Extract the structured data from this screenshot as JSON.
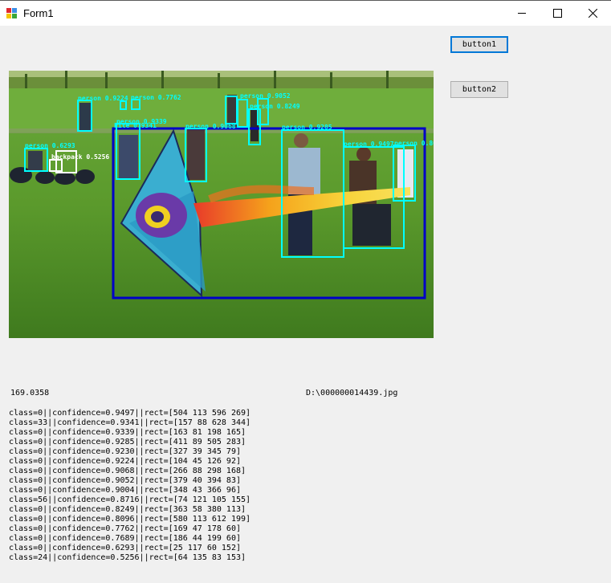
{
  "window": {
    "title": "Form1",
    "controls": [
      "minimize",
      "maximize",
      "close"
    ]
  },
  "buttons": {
    "button1_label": "button1",
    "button2_label": "button2"
  },
  "picture": {
    "description_icon": "detection-result-image",
    "detections": [
      {
        "label": "person 0.9497",
        "color": "#00ffff"
      },
      {
        "label": "kite 0.9341",
        "color": "#0000c8"
      },
      {
        "label": "person 0.9339",
        "color": "#00ffff"
      },
      {
        "label": "person 0.9285",
        "color": "#00ffff"
      },
      {
        "label": "person 0.9230",
        "color": "#00ffff"
      },
      {
        "label": "person 0.9224",
        "color": "#00ffff"
      },
      {
        "label": "person 0.9068",
        "color": "#00ffff"
      },
      {
        "label": "person 0.9052",
        "color": "#00ffff"
      },
      {
        "label": "person 0.9004",
        "color": "#00ffff"
      },
      {
        "label": "",
        "color": "#ffffff"
      },
      {
        "label": "person 0.8249",
        "color": "#00ffff"
      },
      {
        "label": "person 0.8096",
        "color": "#00ffff"
      },
      {
        "label": "person 0.7762",
        "color": "#00ffff"
      },
      {
        "label": "person 0.7689",
        "color": "#00ffff"
      },
      {
        "label": "person 0.6293",
        "color": "#00ffff"
      },
      {
        "label": "backpack 0.5256",
        "color": "#ffffff"
      }
    ]
  },
  "timing_text": "169.0358",
  "file_path": "D:\\000000014439.jpg",
  "results": [
    "class=0||confidence=0.9497||rect=[504 113 596 269]",
    "class=33||confidence=0.9341||rect=[157 88 628 344]",
    "class=0||confidence=0.9339||rect=[163 81 198 165]",
    "class=0||confidence=0.9285||rect=[411 89 505 283]",
    "class=0||confidence=0.9230||rect=[327 39 345 79]",
    "class=0||confidence=0.9224||rect=[104 45 126 92]",
    "class=0||confidence=0.9068||rect=[266 88 298 168]",
    "class=0||confidence=0.9052||rect=[379 40 394 83]",
    "class=0||confidence=0.9004||rect=[348 43 366 96]",
    "class=56||confidence=0.8716||rect=[74 121 105 155]",
    "class=0||confidence=0.8249||rect=[363 58 380 113]",
    "class=0||confidence=0.8096||rect=[580 113 612 199]",
    "class=0||confidence=0.7762||rect=[169 47 178 60]",
    "class=0||confidence=0.7689||rect=[186 44 199 60]",
    "class=0||confidence=0.6293||rect=[25 117 60 152]",
    "class=24||confidence=0.5256||rect=[64 135 83 153]"
  ]
}
